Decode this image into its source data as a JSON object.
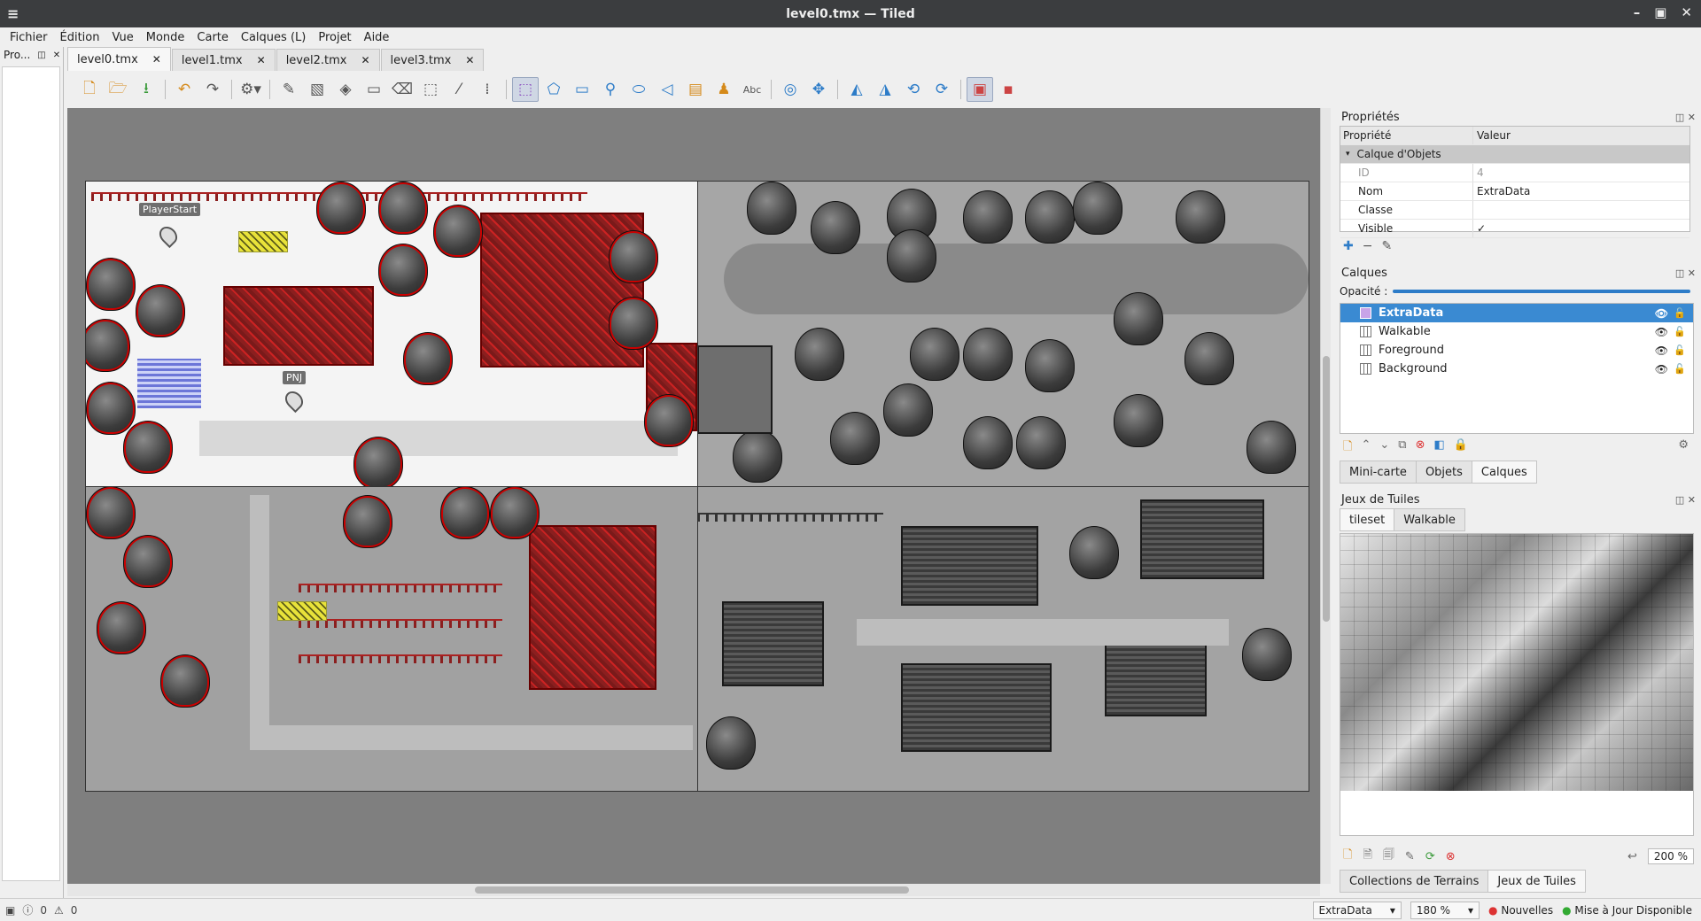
{
  "window": {
    "title": "level0.tmx — Tiled"
  },
  "menu": [
    "Fichier",
    "Édition",
    "Vue",
    "Monde",
    "Carte",
    "Calques (L)",
    "Projet",
    "Aide"
  ],
  "left_panel": {
    "title": "Pro..."
  },
  "tabs": [
    {
      "label": "level0.tmx",
      "active": true
    },
    {
      "label": "level1.tmx",
      "active": false
    },
    {
      "label": "level2.tmx",
      "active": false
    },
    {
      "label": "level3.tmx",
      "active": false
    }
  ],
  "map": {
    "labels": {
      "player_start": "PlayerStart",
      "npc": "PNJ"
    }
  },
  "properties": {
    "title": "Propriétés",
    "col_property": "Propriété",
    "col_value": "Valeur",
    "group": "Calque d'Objets",
    "rows": [
      {
        "k": "ID",
        "v": "4"
      },
      {
        "k": "Nom",
        "v": "ExtraData"
      },
      {
        "k": "Classe",
        "v": ""
      },
      {
        "k": "Visible",
        "v": "✓"
      }
    ]
  },
  "layers_panel": {
    "title": "Calques",
    "opacity_label": "Opacité :",
    "opacity": 1.0,
    "items": [
      {
        "label": "ExtraData",
        "selected": true
      },
      {
        "label": "Walkable",
        "selected": false
      },
      {
        "label": "Foreground",
        "selected": false
      },
      {
        "label": "Background",
        "selected": false
      }
    ]
  },
  "mid_tabs": [
    "Mini-carte",
    "Objets",
    "Calques"
  ],
  "tilesets": {
    "title": "Jeux de Tuiles",
    "tabs": [
      "tileset",
      "Walkable"
    ],
    "zoom": "200 %"
  },
  "bottom_tabs": [
    "Collections de Terrains",
    "Jeux de Tuiles"
  ],
  "status": {
    "errors": "0",
    "warnings": "0",
    "layer": "ExtraData",
    "zoom": "180 %",
    "news": "Nouvelles",
    "update": "Mise à Jour Disponible"
  },
  "colors": {
    "accent": "#3a8ad2",
    "selection_tint": "#c22"
  }
}
